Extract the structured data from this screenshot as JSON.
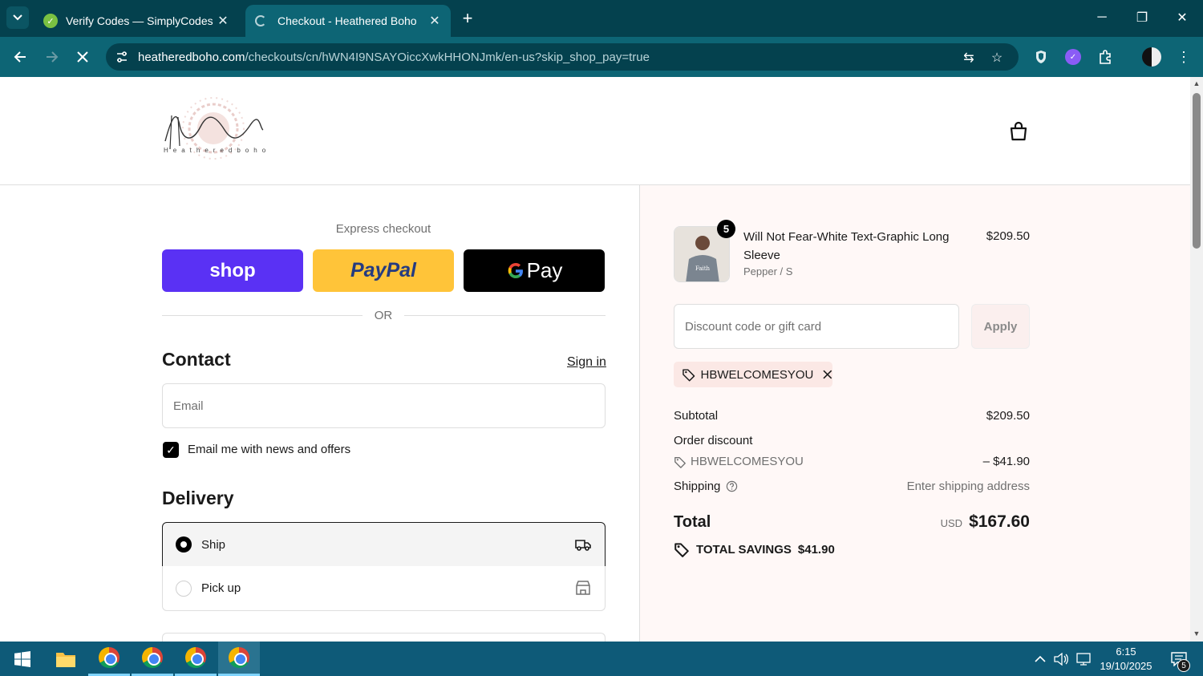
{
  "browser": {
    "tabs": [
      {
        "title": "Verify Codes — SimplyCodes",
        "active": false
      },
      {
        "title": "Checkout - Heathered Boho",
        "active": true
      }
    ],
    "url_domain": "heatheredboho.com",
    "url_path": "/checkouts/cn/hWN4I9NSAYOiccXwkHHONJmk/en-us?skip_shop_pay=true"
  },
  "header": {
    "brand": "Heathered Boho",
    "brand_sub": "Heatheredboho"
  },
  "express": {
    "label": "Express checkout",
    "shop_label": "shop",
    "paypal_label": "PayPal",
    "gpay_label": "Pay",
    "or_label": "OR"
  },
  "contact": {
    "heading": "Contact",
    "signin": "Sign in",
    "email_placeholder": "Email",
    "news_label": "Email me with news and offers",
    "news_checked": true
  },
  "delivery": {
    "heading": "Delivery",
    "options": [
      {
        "label": "Ship",
        "selected": true
      },
      {
        "label": "Pick up",
        "selected": false
      }
    ]
  },
  "summary": {
    "product": {
      "name": "Will Not Fear-White Text-Graphic Long Sleeve",
      "variant": "Pepper / S",
      "price": "$209.50",
      "quantity": "5",
      "thumb_text": "Faith"
    },
    "discount_placeholder": "Discount code or gift card",
    "apply_label": "Apply",
    "applied_code": "HBWELCOMESYOU",
    "subtotal_label": "Subtotal",
    "subtotal_value": "$209.50",
    "order_discount_label": "Order discount",
    "discount_code": "HBWELCOMESYOU",
    "discount_value": "– $41.90",
    "shipping_label": "Shipping",
    "shipping_value": "Enter shipping address",
    "total_label": "Total",
    "currency": "USD",
    "total_value": "$167.60",
    "savings_label": "TOTAL SAVINGS",
    "savings_value": "$41.90"
  },
  "taskbar": {
    "time": "6:15",
    "date": "19/10/2025",
    "notif_count": "5"
  },
  "colors": {
    "shop": "#5a31f4",
    "paypal": "#ffc439",
    "chrome_dark": "#04414e",
    "chrome_light": "#0d6575"
  }
}
